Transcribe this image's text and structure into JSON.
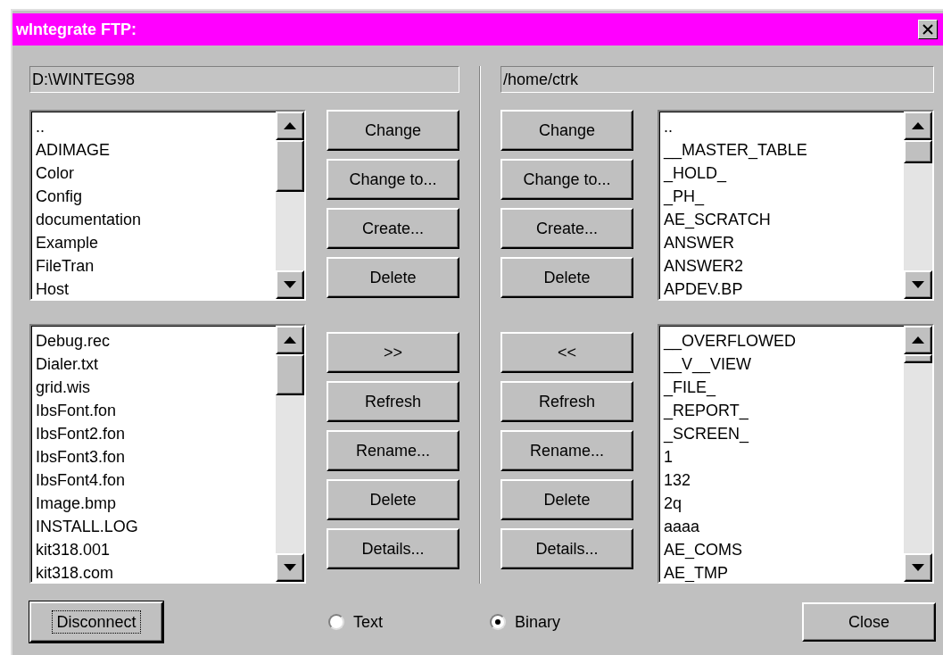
{
  "window": {
    "title": "wIntegrate FTP:"
  },
  "local": {
    "path": "D:\\WINTEG98",
    "directories": [
      "..",
      "ADIMAGE",
      "Color",
      "Config",
      "documentation",
      "Example",
      "FileTran",
      "Host"
    ],
    "files": [
      "Debug.rec",
      "Dialer.txt",
      "grid.wis",
      "IbsFont.fon",
      "IbsFont2.fon",
      "IbsFont3.fon",
      "IbsFont4.fon",
      "Image.bmp",
      "INSTALL.LOG",
      "kit318.001",
      "kit318.com"
    ],
    "directory_buttons": [
      {
        "label": "Change"
      },
      {
        "label": "Change to..."
      },
      {
        "label": "Create..."
      },
      {
        "label": "Delete"
      }
    ],
    "file_buttons": [
      {
        "label": ">>"
      },
      {
        "label": "Refresh"
      },
      {
        "label": "Rename..."
      },
      {
        "label": "Delete"
      },
      {
        "label": "Details..."
      }
    ]
  },
  "remote": {
    "path": "/home/ctrk",
    "directories": [
      "..",
      "__MASTER_TABLE",
      "_HOLD_",
      "_PH_",
      "AE_SCRATCH",
      "ANSWER",
      "ANSWER2",
      "APDEV.BP"
    ],
    "files": [
      "__OVERFLOWED",
      "__V__VIEW",
      "_FILE_",
      "_REPORT_",
      "_SCREEN_",
      "1",
      "132",
      "2q",
      "aaaa",
      "AE_COMS",
      "AE_TMP"
    ],
    "directory_buttons": [
      {
        "label": "Change"
      },
      {
        "label": "Change to..."
      },
      {
        "label": "Create..."
      },
      {
        "label": "Delete"
      }
    ],
    "file_buttons": [
      {
        "label": "<<"
      },
      {
        "label": "Refresh"
      },
      {
        "label": "Rename..."
      },
      {
        "label": "Delete"
      },
      {
        "label": "Details..."
      }
    ]
  },
  "transfer_mode": [
    {
      "label": "Text",
      "selected": false
    },
    {
      "label": "Binary",
      "selected": true
    }
  ],
  "buttons": [
    {
      "label": "Disconnect",
      "focused": true
    },
    {
      "label": "Close",
      "focused": false
    }
  ]
}
